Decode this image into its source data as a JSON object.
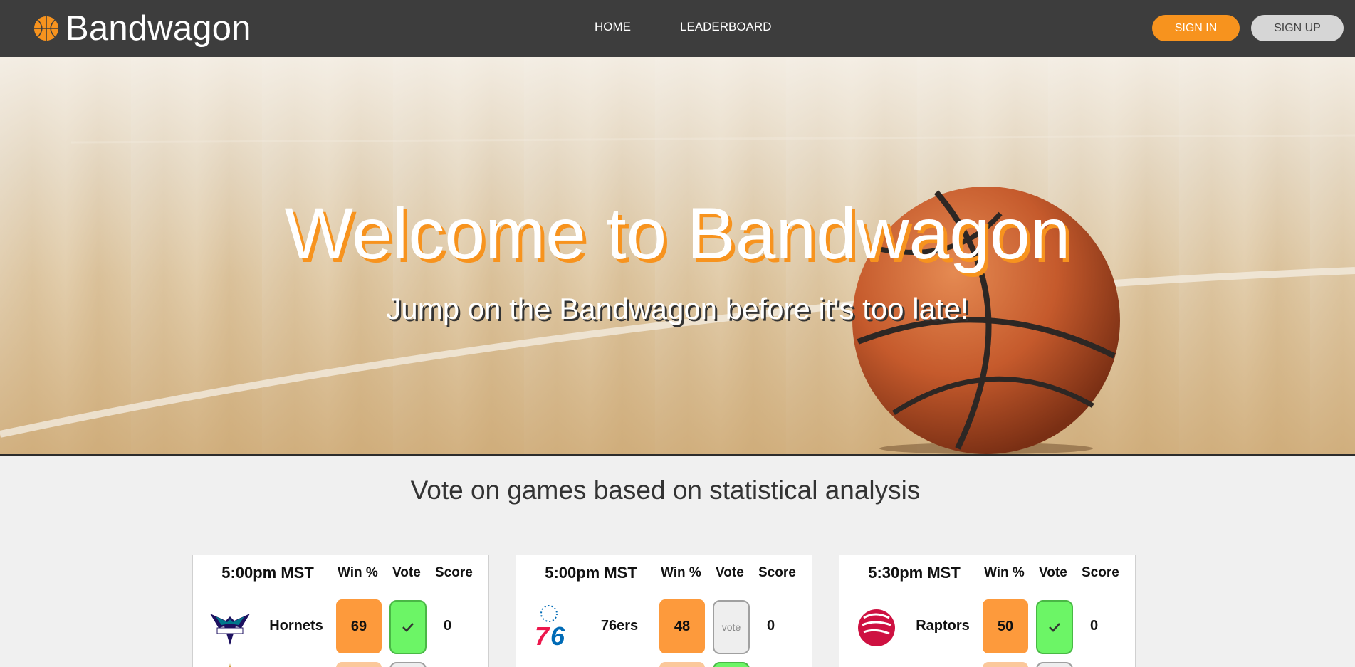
{
  "brand": {
    "name": "Bandwagon",
    "icon": "basketball-icon"
  },
  "nav": {
    "home": "HOME",
    "leaderboard": "LEADERBOARD"
  },
  "auth": {
    "sign_in": "SIGN IN",
    "sign_up": "SIGN UP"
  },
  "hero": {
    "title": "Welcome to Bandwagon",
    "subtitle": "Jump on the Bandwagon before it's too late!"
  },
  "section": {
    "title": "Vote on games based on statistical analysis"
  },
  "headers": {
    "win": "Win %",
    "vote": "Vote",
    "score": "Score"
  },
  "games": [
    {
      "time": "5:00pm MST",
      "team": "Hornets",
      "logo": "hornets-logo",
      "win": "69",
      "vote": "check",
      "score": "0"
    },
    {
      "time": "5:00pm MST",
      "team": "76ers",
      "logo": "sixers-logo",
      "win": "48",
      "vote": "vote",
      "score": "0"
    },
    {
      "time": "5:30pm MST",
      "team": "Raptors",
      "logo": "raptors-logo",
      "win": "50",
      "vote": "check",
      "score": "0"
    }
  ],
  "colors": {
    "accent": "#f7931e",
    "navbar": "#3d3d3d",
    "vote_selected": "#6cf566",
    "win_box": "#fd9a3c"
  }
}
